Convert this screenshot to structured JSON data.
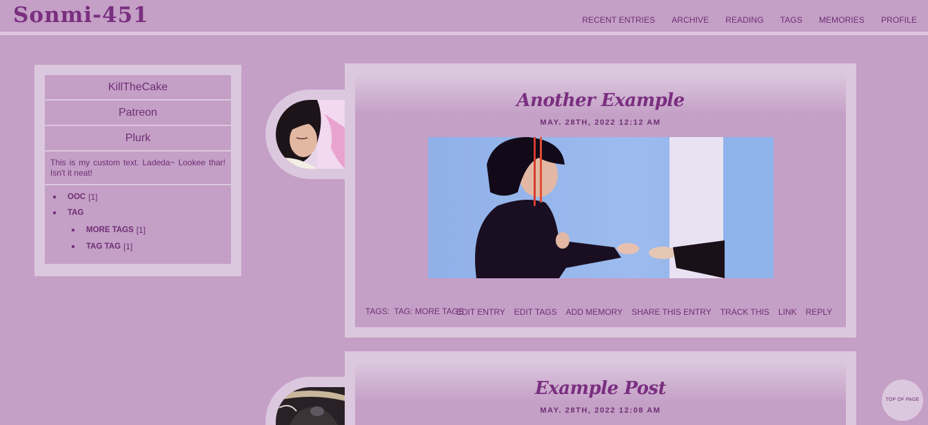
{
  "header": {
    "site_title": "Sonmi-451",
    "nav": [
      "RECENT ENTRIES",
      "ARCHIVE",
      "READING",
      "TAGS",
      "MEMORIES",
      "PROFILE"
    ]
  },
  "sidebar": {
    "links": [
      "KillTheCake",
      "Patreon",
      "Plurk"
    ],
    "custom_text": "This is my custom text. Ladeda~ Lookee thar! Isn't it neat!",
    "tags": [
      {
        "name": "OOC",
        "count": "[1]"
      },
      {
        "name": "TAG",
        "count": ""
      },
      {
        "name": "MORE TAGS",
        "count": "[1]"
      },
      {
        "name": "TAG TAG",
        "count": "[1]"
      }
    ]
  },
  "entries": [
    {
      "title": "Another Example",
      "date": "MAY. 28TH, 2022 12:12 AM",
      "tags_label": "TAGS:",
      "tags_value": "TAG: MORE TAGS",
      "actions": [
        "EDIT ENTRY",
        "EDIT TAGS",
        "ADD MEMORY",
        "SHARE THIS ENTRY",
        "TRACK THIS",
        "LINK",
        "REPLY"
      ]
    },
    {
      "title": "Example Post",
      "date": "MAY. 28TH, 2022 12:08 AM"
    }
  ],
  "top_button": "TOP OF PAGE",
  "colors": {
    "background": "#c49fc6",
    "panel": "#dcc8de",
    "accent": "#7a2f80"
  }
}
